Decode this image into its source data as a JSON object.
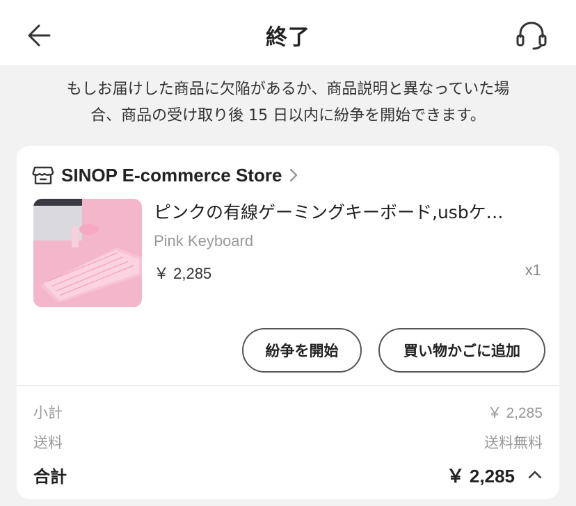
{
  "header": {
    "title": "終了",
    "back_icon": "arrow-left-icon",
    "support_icon": "headset-icon"
  },
  "notice": {
    "line1": "もしお届けした商品に欠陥があるか、商品説明と異なっていた場",
    "line2": "合、商品の受け取り後 15 日以内に紛争を開始できます。"
  },
  "order": {
    "store_icon": "store-icon",
    "store_name": "SINOP E-commerce Store",
    "product": {
      "title": "ピンクの有線ゲーミングキーボード,usbケ…",
      "variant": "Pink Keyboard",
      "price": "￥ 2,285",
      "quantity": "x1"
    },
    "actions": {
      "dispute_label": "紛争を開始",
      "add_to_cart_label": "買い物かごに追加"
    }
  },
  "summary": {
    "subtotal_label": "小計",
    "subtotal_value": "￥ 2,285",
    "shipping_label": "送料",
    "shipping_value": "送料無料",
    "total_label": "合計",
    "total_value": "￥ 2,285"
  },
  "colors": {
    "background": "#f2f2f2",
    "card": "#ffffff",
    "text": "#222222",
    "muted": "#999999"
  }
}
